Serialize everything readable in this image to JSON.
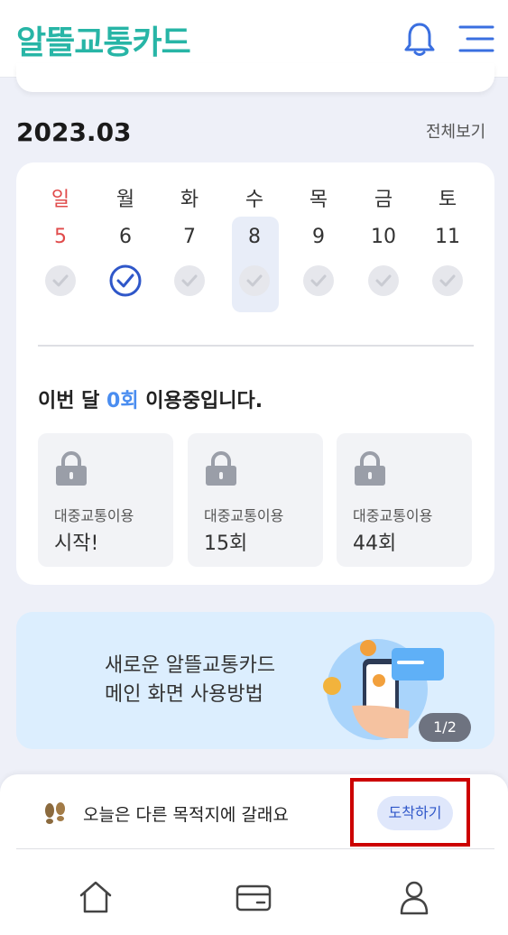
{
  "header": {
    "logo": "알뜰교통카드",
    "bell_icon": "bell-icon",
    "menu_icon": "hamburger-menu-icon"
  },
  "section": {
    "month": "2023.03",
    "view_all": "전체보기"
  },
  "calendar": {
    "days": [
      {
        "name": "일",
        "date": "5",
        "checked": false,
        "sunday": true,
        "today": false
      },
      {
        "name": "월",
        "date": "6",
        "checked": true,
        "sunday": false,
        "today": false
      },
      {
        "name": "화",
        "date": "7",
        "checked": false,
        "sunday": false,
        "today": false
      },
      {
        "name": "수",
        "date": "8",
        "checked": false,
        "sunday": false,
        "today": true
      },
      {
        "name": "목",
        "date": "9",
        "checked": false,
        "sunday": false,
        "today": false
      },
      {
        "name": "금",
        "date": "10",
        "checked": false,
        "sunday": false,
        "today": false
      },
      {
        "name": "토",
        "date": "11",
        "checked": false,
        "sunday": false,
        "today": false
      }
    ]
  },
  "usage": {
    "prefix": "이번 달 ",
    "count": "0회",
    "suffix": " 이용중입니다."
  },
  "badges": [
    {
      "label": "대중교통이용",
      "value": "시작!"
    },
    {
      "label": "대중교통이용",
      "value": "15회"
    },
    {
      "label": "대중교통이용",
      "value": "44회"
    }
  ],
  "banner": {
    "line1": "새로운 알뜰교통카드",
    "line2": "메인 화면 사용방법",
    "pager": "1/2"
  },
  "destination": {
    "text": "오늘은 다른 목적지에 갈래요",
    "button": "도착하기",
    "icon": "footprints-icon"
  },
  "tabs": [
    {
      "icon": "home-icon"
    },
    {
      "icon": "card-icon"
    },
    {
      "icon": "person-icon"
    }
  ],
  "colors": {
    "brand": "#27b5a6",
    "accent": "#4a8df0",
    "sunday": "#e04a4a",
    "highlight_box": "#cc0000",
    "button_text": "#2f57c9"
  }
}
